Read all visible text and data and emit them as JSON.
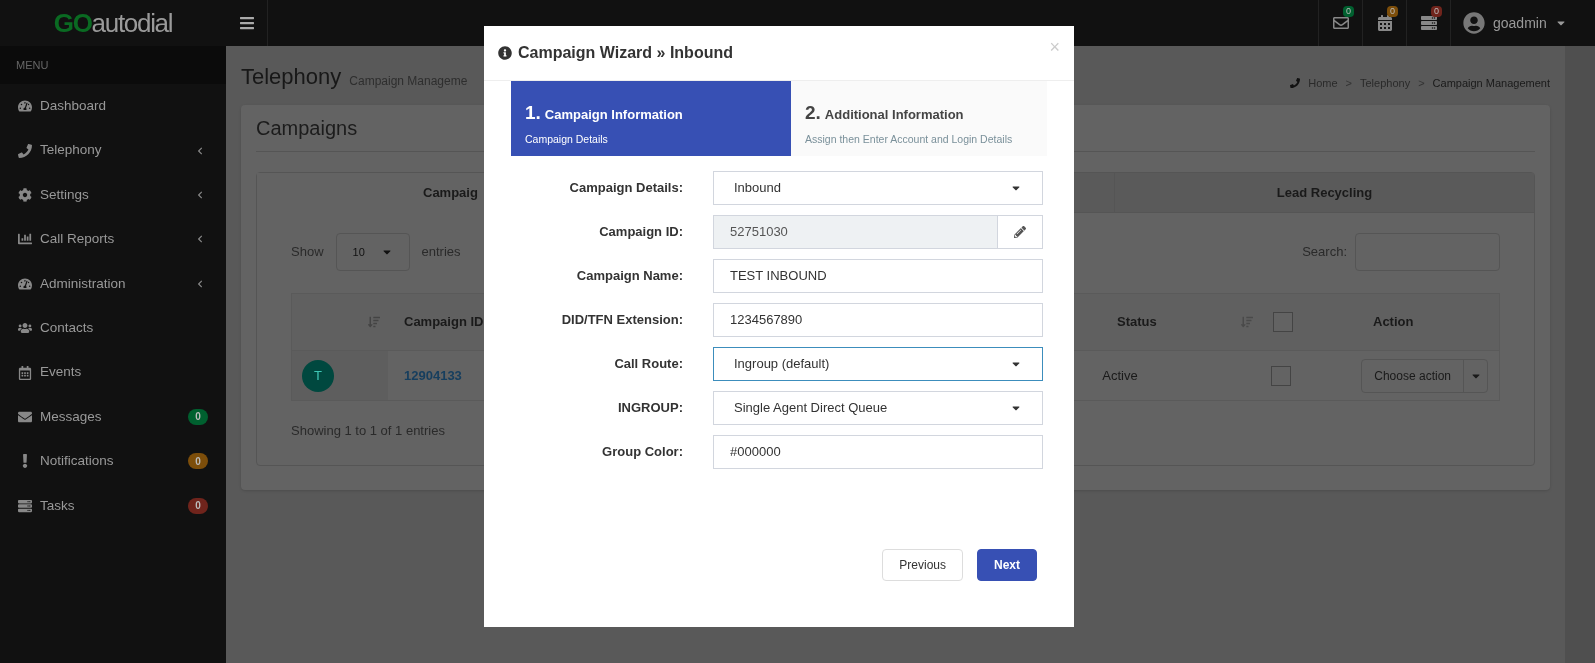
{
  "header": {
    "logo_go": "GO",
    "logo_rest": "autodial",
    "notifications": [
      {
        "kind": "mail",
        "count": "0",
        "color": "#00602f"
      },
      {
        "kind": "calendar",
        "count": "0",
        "color": "#7d4e0a"
      },
      {
        "kind": "tasks",
        "count": "0",
        "color": "#70241c"
      }
    ],
    "user": "goadmin"
  },
  "sidebar": {
    "heading": "MENU",
    "items": [
      {
        "label": "Dashboard",
        "submenu": false
      },
      {
        "label": "Telephony",
        "submenu": true
      },
      {
        "label": "Settings",
        "submenu": true
      },
      {
        "label": "Call Reports",
        "submenu": true
      },
      {
        "label": "Administration",
        "submenu": true
      },
      {
        "label": "Contacts",
        "submenu": false
      },
      {
        "label": "Events",
        "submenu": false
      },
      {
        "label": "Messages",
        "submenu": false,
        "badge": "0",
        "color": "#00602f"
      },
      {
        "label": "Notifications",
        "submenu": false,
        "badge": "0",
        "color": "#7d4e0a"
      },
      {
        "label": "Tasks",
        "submenu": false,
        "badge": "0",
        "color": "#70241c"
      }
    ]
  },
  "page": {
    "title": "Telephony",
    "subtitle": "Campaign Manageme",
    "breadcrumb": [
      "Home",
      "Telephony",
      "Campaign Management"
    ],
    "separator": ">",
    "box_title": "Campaigns",
    "tabs": [
      {
        "label": "Campaig",
        "selected": true
      },
      {
        "label": "Lead Recycling",
        "selected": false
      }
    ],
    "show_label": "Show",
    "page_size": "10",
    "entries_label": "entries",
    "search_label": "Search:",
    "columns": [
      "Campaign ID",
      "Status",
      "Action"
    ],
    "select_all_checked": false,
    "rows": [
      {
        "avatar": "T",
        "campaign_id": "12904133",
        "status": "Active",
        "checked": false,
        "action": "Choose action"
      }
    ],
    "footer": "Showing 1 to 1 of 1 entries"
  },
  "modal": {
    "title": "Campaign Wizard » Inbound",
    "close": "×",
    "steps": [
      {
        "number": "1.",
        "title": "Campaign Information",
        "subtitle": "Campaign Details",
        "selected": true
      },
      {
        "number": "2.",
        "title": "Additional Information",
        "subtitle": "Assign then Enter Account and Login Details",
        "selected": false
      }
    ],
    "fields": [
      {
        "kind": "select",
        "label": "Campaign Details:",
        "value": "Inbound",
        "focused": false
      },
      {
        "kind": "locked",
        "label": "Campaign ID:",
        "value": "52751030",
        "focused": false
      },
      {
        "kind": "input",
        "label": "Campaign Name:",
        "value": "TEST INBOUND",
        "focused": false
      },
      {
        "kind": "input",
        "label": "DID/TFN Extension:",
        "value": "1234567890",
        "focused": false
      },
      {
        "kind": "select",
        "label": "Call Route:",
        "value": "Ingroup (default)",
        "focused": true
      },
      {
        "kind": "select",
        "label": "INGROUP:",
        "value": "Single Agent Direct Queue",
        "focused": false
      },
      {
        "kind": "input",
        "label": "Group Color:",
        "value": "#000000",
        "focused": false
      }
    ],
    "buttons": [
      {
        "label": "Previous",
        "primary": false
      },
      {
        "label": "Next",
        "primary": true
      }
    ]
  }
}
